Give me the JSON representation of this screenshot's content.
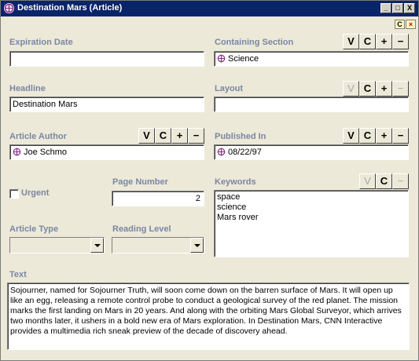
{
  "window": {
    "title": "Destination Mars (Article)",
    "minimize": "_",
    "maximize": "□",
    "close": "X"
  },
  "corner": {
    "c": "C",
    "x": "×"
  },
  "fields": {
    "expiration_date": {
      "label": "Expiration Date",
      "value": ""
    },
    "containing_section": {
      "label": "Containing Section",
      "value": "Science"
    },
    "headline": {
      "label": "Headline",
      "value": "Destination Mars"
    },
    "layout": {
      "label": "Layout",
      "value": ""
    },
    "article_author": {
      "label": "Article Author",
      "value": "Joe Schmo"
    },
    "published_in": {
      "label": "Published In",
      "value": "08/22/97"
    },
    "urgent": {
      "label": "Urgent",
      "checked": false
    },
    "page_number": {
      "label": "Page Number",
      "value": "2"
    },
    "keywords": {
      "label": "Keywords",
      "items": [
        "space",
        "science",
        "Mars rover"
      ]
    },
    "article_type": {
      "label": "Article Type",
      "value": ""
    },
    "reading_level": {
      "label": "Reading Level",
      "value": ""
    },
    "text": {
      "label": "Text",
      "lines": [
        "Sojourner, named for Sojourner Truth, will soon come down on the barren surface of Mars. It will open up",
        "like an egg, releasing a remote control probe to conduct a geological survey of the red planet. The mission",
        "marks the first landing on Mars in 20 years. And along with the orbiting Mars Global Surveyor, which arrives",
        "two months later, it ushers in a bold new era of Mars exploration.  In Destination Mars, CNN Interactive",
        "provides a multimedia rich sneak preview of the decade of discovery ahead."
      ]
    }
  },
  "toolbar": {
    "v": "V",
    "c": "C",
    "plus": "+",
    "minus": "−"
  },
  "colors": {
    "title_bg": "#0a246a",
    "label": "#7b86a4",
    "ref_icon": "#8a2d8a"
  }
}
